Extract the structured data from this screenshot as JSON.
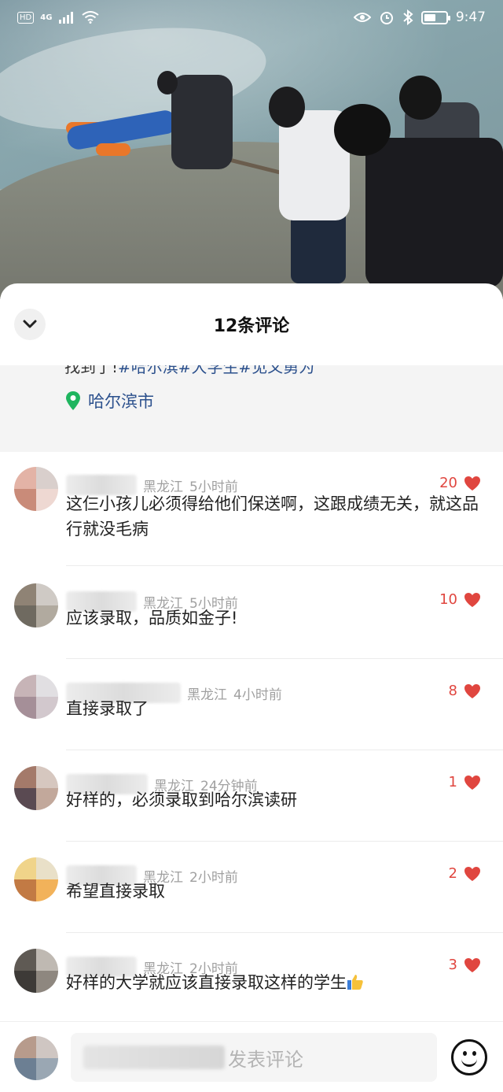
{
  "status_bar": {
    "hd_label": "HD",
    "network_label": "4G",
    "time": "9:47",
    "battery_level": 0.55
  },
  "sheet": {
    "title": "12条评论"
  },
  "post": {
    "text_prefix": "找到了!",
    "hashtags": "#哈尔滨#大学生#见义勇为",
    "location": "哈尔滨市"
  },
  "comments": [
    {
      "region": "黑龙江",
      "time": "5小时前",
      "likes": "20",
      "text": "这仨小孩儿必须得给他们保送啊，这跟成绩无关，就这品行就没毛病"
    },
    {
      "region": "黑龙江",
      "time": "5小时前",
      "likes": "10",
      "text": "应该录取，品质如金子!"
    },
    {
      "region": "黑龙江",
      "time": "4小时前",
      "likes": "8",
      "text": "直接录取了"
    },
    {
      "region": "黑龙江",
      "time": "24分钟前",
      "likes": "1",
      "text": "好样的，必须录取到哈尔滨读研"
    },
    {
      "region": "黑龙江",
      "time": "2小时前",
      "likes": "2",
      "text": "希望直接录取"
    },
    {
      "region": "黑龙江",
      "time": "2小时前",
      "likes": "3",
      "text": "好样的大学就应该直接录取这样的学生"
    }
  ],
  "input_bar": {
    "placeholder": "发表评论"
  },
  "colors": {
    "like_red": "#e0463f",
    "link_blue": "#2a4f8c",
    "location_green": "#1fb55f"
  }
}
